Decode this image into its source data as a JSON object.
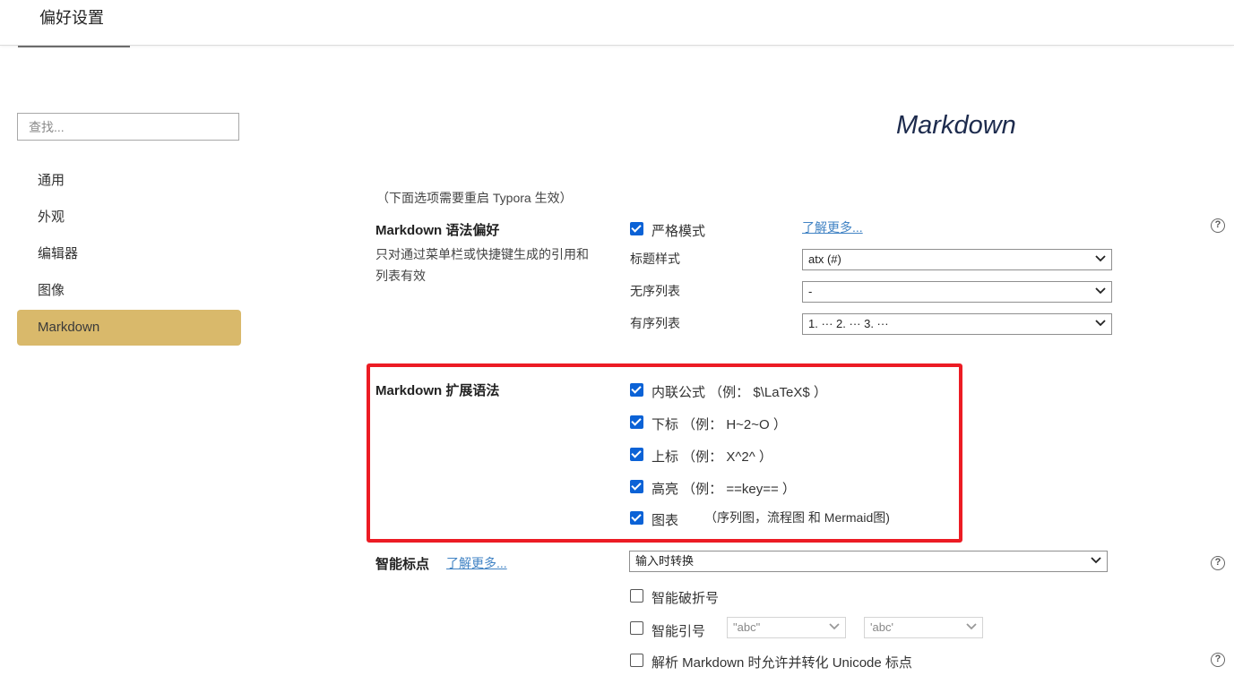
{
  "window": {
    "title": "偏好设置"
  },
  "search": {
    "placeholder": "查找..."
  },
  "sidebar": {
    "items": [
      {
        "label": "通用",
        "active": false
      },
      {
        "label": "外观",
        "active": false
      },
      {
        "label": "编辑器",
        "active": false
      },
      {
        "label": "图像",
        "active": false
      },
      {
        "label": "Markdown",
        "active": true
      }
    ]
  },
  "main": {
    "heading": "Markdown",
    "restart_note": "（下面选项需要重启 Typora 生效）",
    "syntax_pref": {
      "label": "Markdown 语法偏好",
      "description": "只对通过菜单栏或快捷键生成的引用和列表有效",
      "strict_mode": {
        "label": "严格模式",
        "checked": true
      },
      "learn_more": "了解更多...",
      "heading_style": {
        "label": "标题样式",
        "value": "atx (#)"
      },
      "unordered_list": {
        "label": "无序列表",
        "value": "-"
      },
      "ordered_list": {
        "label": "有序列表",
        "value": "1. ··· 2. ··· 3. ···"
      }
    },
    "extended_syntax": {
      "label": "Markdown 扩展语法",
      "options": [
        {
          "label": "内联公式 （例： $\\LaTeX$ ）",
          "checked": true
        },
        {
          "label": "下标 （例： H~2~O ）",
          "checked": true
        },
        {
          "label": "上标 （例： X^2^ ）",
          "checked": true
        },
        {
          "label": "高亮 （例： ==key== ）",
          "checked": true
        },
        {
          "label": "图表",
          "note": "（序列图，流程图 和 Mermaid图)",
          "checked": true
        }
      ]
    },
    "smart_punctuation": {
      "label": "智能标点",
      "learn_more": "了解更多...",
      "mode": "输入时转换",
      "smart_dash": {
        "label": "智能破折号",
        "checked": false
      },
      "smart_quotes": {
        "label": "智能引号",
        "checked": false,
        "double_value": "\"abc\"",
        "single_value": "'abc'"
      },
      "unicode_punct": {
        "label": "解析 Markdown 时允许并转化 Unicode 标点",
        "checked": false
      }
    }
  },
  "colors": {
    "accent": "#d9b96b",
    "checkbox": "#0b62d6",
    "highlight_border": "#ec1c24",
    "link": "#4183c4"
  }
}
